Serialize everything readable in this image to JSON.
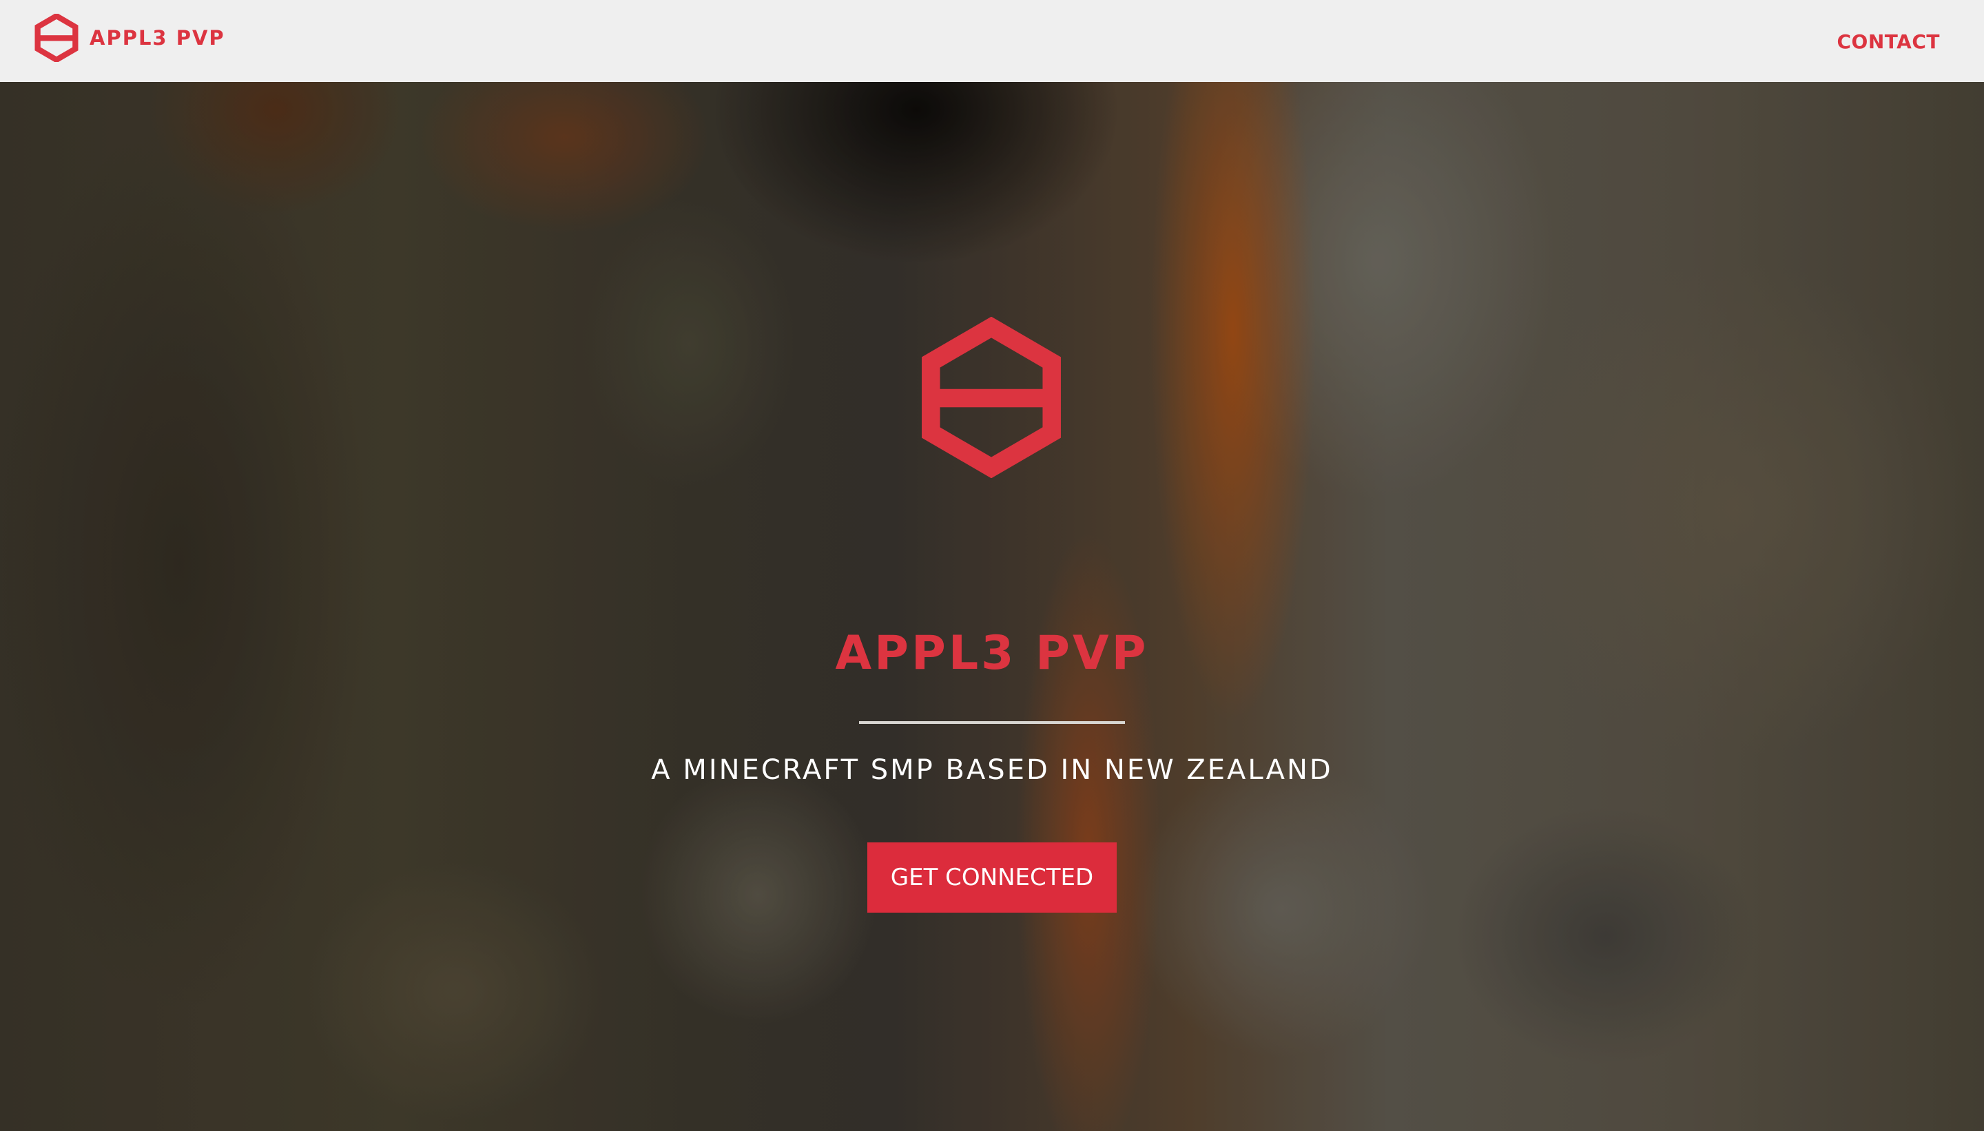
{
  "nav": {
    "brand_name": "APPL3 PVP",
    "brand_icon": "hexagon-logo-icon",
    "contact_label": "CONTACT"
  },
  "hero": {
    "logo_icon": "hexagon-logo-icon",
    "title": "APPL3 PVP",
    "subtitle": "A MINECRAFT SMP BASED IN NEW ZEALAND",
    "cta_label": "GET CONNECTED"
  },
  "colors": {
    "accent": "#dc3440",
    "button": "#dc2c3c",
    "navbar_bg": "#efefef",
    "subtitle_text": "#ffffff",
    "divider": "#d8d6d2"
  }
}
